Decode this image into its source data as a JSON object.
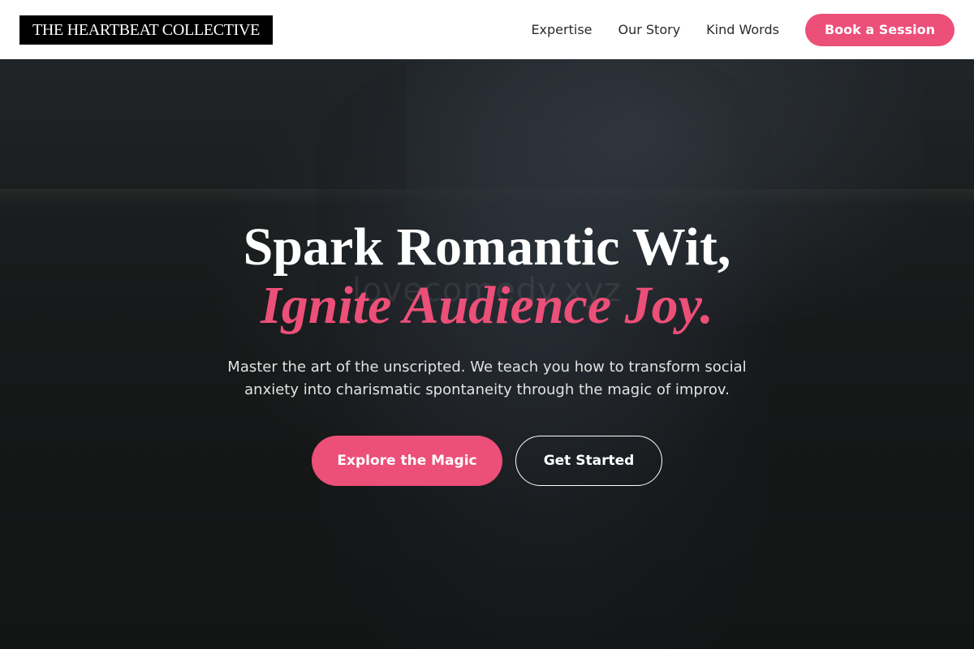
{
  "header": {
    "logo_text": "THE HEARTBEAT COLLECTIVE",
    "nav": [
      {
        "label": "Expertise"
      },
      {
        "label": "Our Story"
      },
      {
        "label": "Kind Words"
      }
    ],
    "cta_label": "Book a Session"
  },
  "hero": {
    "watermark": "lovecomedy.xyz",
    "headline_line1": "Spark Romantic Wit,",
    "headline_line2": "Ignite Audience Joy.",
    "subtitle": "Master the art of the unscripted. We teach you how to transform social anxiety into charismatic spontaneity through the magic of improv.",
    "primary_button": "Explore the Magic",
    "secondary_button": "Get Started"
  },
  "colors": {
    "accent": "#ec4f78",
    "header_bg": "#ffffff",
    "logo_bg": "#000000"
  }
}
